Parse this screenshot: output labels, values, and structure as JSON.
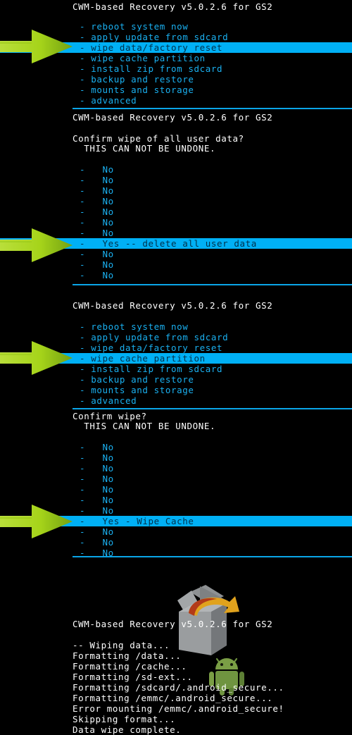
{
  "colors": {
    "background": "#000000",
    "title_text": "#ffffff",
    "menu_text": "#1ab0f0",
    "highlight_bg": "#00b0f5",
    "highlight_text": "#00304a",
    "divider": "#0aa5e8",
    "arrow_green": "#a6d41a",
    "android_green": "#6b8f3a",
    "box_grey": "#9a9a9a",
    "box_arrow_orange": "#e0a01c"
  },
  "app": {
    "title": "CWM-based Recovery v5.0.2.6 for GS2"
  },
  "screens": [
    {
      "id": "main-menu-wipe-data",
      "title": "CWM-based Recovery v5.0.2.6 for GS2",
      "items": [
        {
          "dash": "-",
          "label": "reboot system now",
          "selected": false
        },
        {
          "dash": "-",
          "label": "apply update from sdcard",
          "selected": false
        },
        {
          "dash": "-",
          "label": "wipe data/factory reset",
          "selected": true
        },
        {
          "dash": "-",
          "label": "wipe cache partition",
          "selected": false
        },
        {
          "dash": "-",
          "label": "install zip from sdcard",
          "selected": false
        },
        {
          "dash": "-",
          "label": "backup and restore",
          "selected": false
        },
        {
          "dash": "-",
          "label": "mounts and storage",
          "selected": false
        },
        {
          "dash": "-",
          "label": "advanced",
          "selected": false
        }
      ]
    },
    {
      "id": "confirm-wipe-data",
      "title": "CWM-based Recovery v5.0.2.6 for GS2",
      "prompt_line_1": "Confirm wipe of all user data?",
      "prompt_line_2": "  THIS CAN NOT BE UNDONE.",
      "items": [
        {
          "dash": "-",
          "label": "No",
          "selected": false
        },
        {
          "dash": "-",
          "label": "No",
          "selected": false
        },
        {
          "dash": "-",
          "label": "No",
          "selected": false
        },
        {
          "dash": "-",
          "label": "No",
          "selected": false
        },
        {
          "dash": "-",
          "label": "No",
          "selected": false
        },
        {
          "dash": "-",
          "label": "No",
          "selected": false
        },
        {
          "dash": "-",
          "label": "No",
          "selected": false
        },
        {
          "dash": "-",
          "label": "Yes -- delete all user data",
          "selected": true
        },
        {
          "dash": "-",
          "label": "No",
          "selected": false
        },
        {
          "dash": "-",
          "label": "No",
          "selected": false
        },
        {
          "dash": "-",
          "label": "No",
          "selected": false
        }
      ]
    },
    {
      "id": "main-menu-wipe-cache",
      "title": "CWM-based Recovery v5.0.2.6 for GS2",
      "items": [
        {
          "dash": "-",
          "label": "reboot system now",
          "selected": false
        },
        {
          "dash": "-",
          "label": "apply update from sdcard",
          "selected": false
        },
        {
          "dash": "-",
          "label": "wipe data/factory reset",
          "selected": false
        },
        {
          "dash": "-",
          "label": "wipe cache partition",
          "selected": true
        },
        {
          "dash": "-",
          "label": "install zip from sdcard",
          "selected": false
        },
        {
          "dash": "-",
          "label": "backup and restore",
          "selected": false
        },
        {
          "dash": "-",
          "label": "mounts and storage",
          "selected": false
        },
        {
          "dash": "-",
          "label": "advanced",
          "selected": false
        }
      ]
    },
    {
      "id": "confirm-wipe-cache",
      "prompt_line_1": "Confirm wipe?",
      "prompt_line_2": "  THIS CAN NOT BE UNDONE.",
      "items": [
        {
          "dash": "-",
          "label": "No",
          "selected": false
        },
        {
          "dash": "-",
          "label": "No",
          "selected": false
        },
        {
          "dash": "-",
          "label": "No",
          "selected": false
        },
        {
          "dash": "-",
          "label": "No",
          "selected": false
        },
        {
          "dash": "-",
          "label": "No",
          "selected": false
        },
        {
          "dash": "-",
          "label": "No",
          "selected": false
        },
        {
          "dash": "-",
          "label": "No",
          "selected": false
        },
        {
          "dash": "-",
          "label": "Yes - Wipe Cache",
          "selected": true
        },
        {
          "dash": "-",
          "label": "No",
          "selected": false
        },
        {
          "dash": "-",
          "label": "No",
          "selected": false
        },
        {
          "dash": "-",
          "label": "No",
          "selected": false
        }
      ]
    },
    {
      "id": "wipe-log",
      "title": "CWM-based Recovery v5.0.2.6 for GS2",
      "log_lines": [
        "-- Wiping data...",
        "Formatting /data...",
        "Formatting /cache...",
        "Formatting /sd-ext...",
        "Formatting /sdcard/.android_secure...",
        "Formatting /emmc/.android_secure...",
        "Error mounting /emmc/.android_secure!",
        "Skipping format...",
        "Data wipe complete."
      ]
    }
  ],
  "annotations": {
    "arrows": [
      {
        "name": "pointer-arrow-wipe-data",
        "points_to": "wipe data/factory reset"
      },
      {
        "name": "pointer-arrow-yes-delete",
        "points_to": "Yes -- delete all user data"
      },
      {
        "name": "pointer-arrow-wipe-cache",
        "points_to": "wipe cache partition"
      },
      {
        "name": "pointer-arrow-yes-wipe-cache",
        "points_to": "Yes - Wipe Cache"
      }
    ]
  },
  "graphics": {
    "cwm_box_logo": "cwm-box-logo",
    "android_robot": "android-robot-icon"
  }
}
